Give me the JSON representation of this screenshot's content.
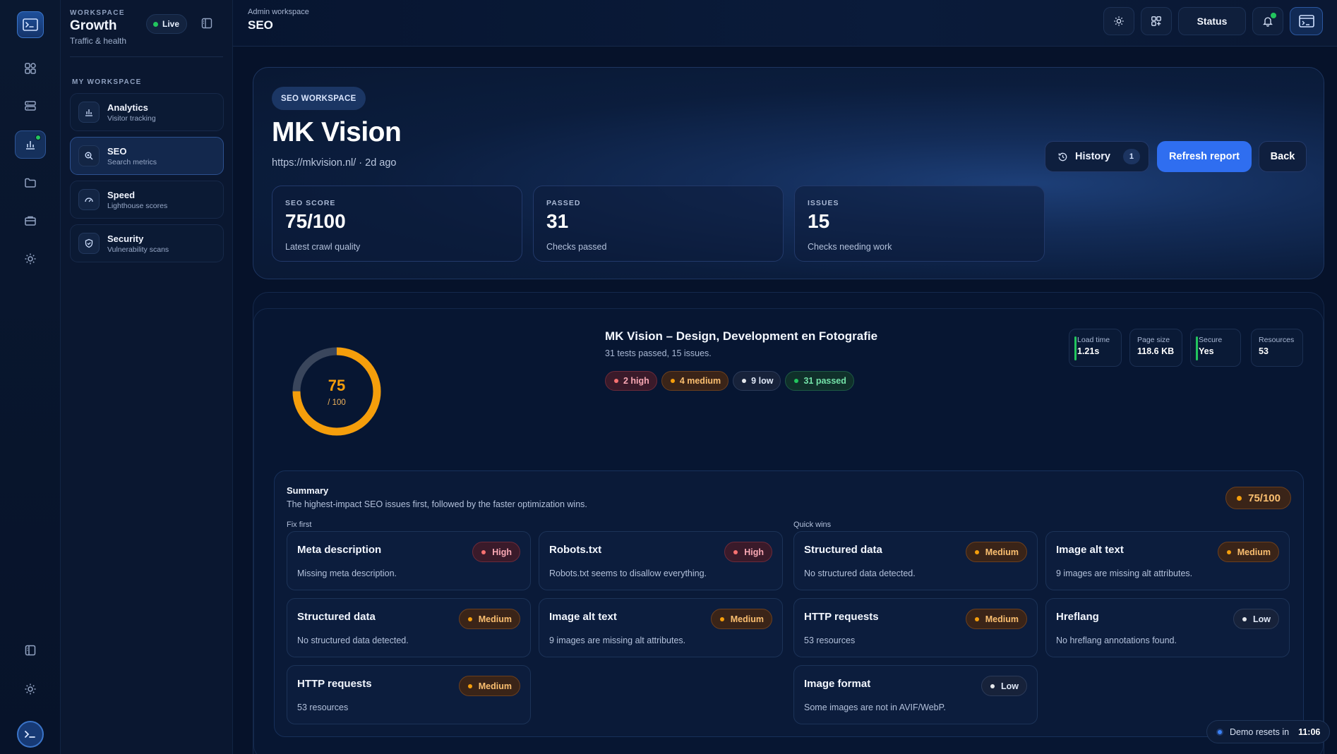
{
  "sidebar": {
    "workspace_kicker": "WORKSPACE",
    "workspace_name": "Growth",
    "workspace_sub": "Traffic & health",
    "live_label": "Live",
    "section_heading": "MY WORKSPACE",
    "items": [
      {
        "label": "Analytics",
        "sub": "Visitor tracking",
        "icon": "bar-chart-icon"
      },
      {
        "label": "SEO",
        "sub": "Search metrics",
        "icon": "search-icon"
      },
      {
        "label": "Speed",
        "sub": "Lighthouse scores",
        "icon": "gauge-icon"
      },
      {
        "label": "Security",
        "sub": "Vulnerability scans",
        "icon": "shield-icon"
      }
    ]
  },
  "topbar": {
    "breadcrumb": "Admin workspace",
    "title": "SEO",
    "status_label": "Status"
  },
  "hero": {
    "kicker": "SEO WORKSPACE",
    "title": "MK Vision",
    "subtitle": "https://mkvision.nl/ · 2d ago",
    "history_label": "History",
    "history_count": "1",
    "refresh_label": "Refresh report",
    "back_label": "Back",
    "stats": [
      {
        "kicker": "SEO SCORE",
        "value": "75/100",
        "sub": "Latest crawl quality"
      },
      {
        "kicker": "PASSED",
        "value": "31",
        "sub": "Checks passed"
      },
      {
        "kicker": "ISSUES",
        "value": "15",
        "sub": "Checks needing work"
      }
    ]
  },
  "report": {
    "score": "75",
    "score_den": "/ 100",
    "score_fraction": 0.75,
    "site_title": "MK Vision – Design, Development en Fotografie",
    "site_sub": "31 tests passed, 15 issues.",
    "chips": {
      "high": "2 high",
      "medium": "4 medium",
      "low": "9 low",
      "passed": "31 passed"
    },
    "metrics": [
      {
        "label": "Load time",
        "value": "1.21s"
      },
      {
        "label": "Page size",
        "value": "118.6 KB"
      },
      {
        "label": "Secure",
        "value": "Yes"
      },
      {
        "label": "Resources",
        "value": "53"
      }
    ]
  },
  "summary": {
    "title": "Summary",
    "description": "The highest-impact SEO issues first, followed by the faster optimization wins.",
    "score_badge": "75/100",
    "fix_first_heading": "Fix first",
    "quick_wins_heading": "Quick wins",
    "fix_first": [
      {
        "title": "Meta description",
        "desc": "Missing meta description.",
        "severity": "High"
      },
      {
        "title": "Robots.txt",
        "desc": "Robots.txt seems to disallow everything.",
        "severity": "High"
      },
      {
        "title": "Structured data",
        "desc": "No structured data detected.",
        "severity": "Medium"
      },
      {
        "title": "Image alt text",
        "desc": "9 images are missing alt attributes.",
        "severity": "Medium"
      },
      {
        "title": "HTTP requests",
        "desc": "53 resources",
        "severity": "Medium"
      }
    ],
    "quick_wins": [
      {
        "title": "Structured data",
        "desc": "No structured data detected.",
        "severity": "Medium"
      },
      {
        "title": "Image alt text",
        "desc": "9 images are missing alt attributes.",
        "severity": "Medium"
      },
      {
        "title": "HTTP requests",
        "desc": "53 resources",
        "severity": "Medium"
      },
      {
        "title": "Hreflang",
        "desc": "No hreflang annotations found.",
        "severity": "Low"
      },
      {
        "title": "Image format",
        "desc": "Some images are not in AVIF/WebP.",
        "severity": "Low"
      }
    ]
  },
  "demo": {
    "label": "Demo resets in",
    "time": "11:06"
  },
  "colors": {
    "accent": "#2f6ef0",
    "high": "#f87171",
    "medium": "#f59e0b",
    "passed": "#22c55e"
  }
}
